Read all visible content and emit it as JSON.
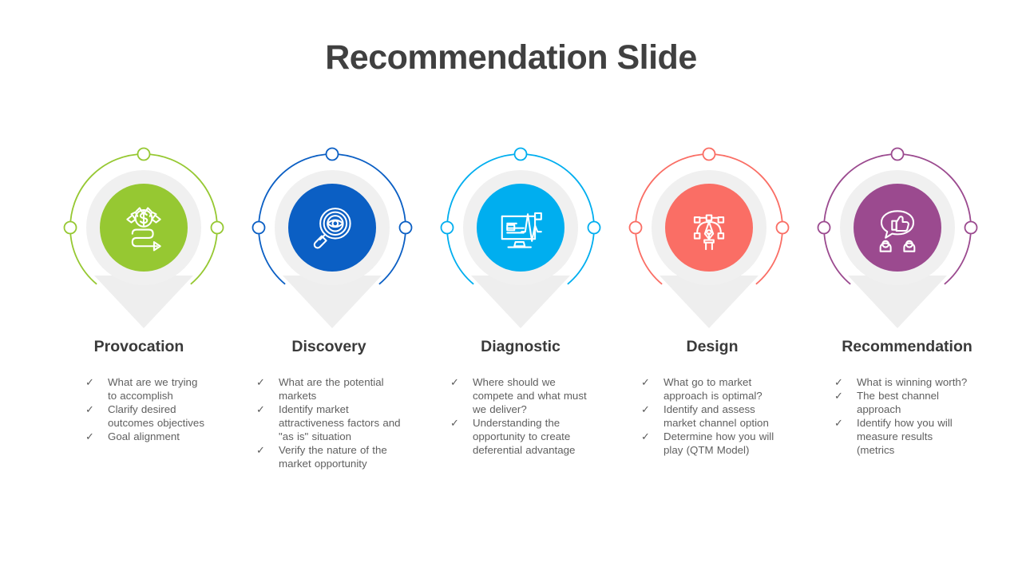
{
  "slide": {
    "title": "Recommendation Slide",
    "background": "#ffffff",
    "title_color": "#404040",
    "arrow_color": "#eeeeee",
    "donut_color": "#f0f0f0",
    "text_color": "#5f5f5f",
    "heading_color": "#3a3a3a",
    "check_glyph": "✓"
  },
  "columns": [
    {
      "id": "provocation",
      "heading": "Provocation",
      "color": "#96C832",
      "icon": "money-growth-icon",
      "bullets": [
        "What are we trying to accomplish",
        "Clarify desired outcomes objectives",
        "Goal alignment"
      ]
    },
    {
      "id": "discovery",
      "heading": "Discovery",
      "color": "#0B5FC4",
      "icon": "magnifier-eye-icon",
      "bullets": [
        "What are the potential markets",
        "Identify market attractiveness factors and \"as is\" situation",
        "Verify the nature of the market opportunity"
      ]
    },
    {
      "id": "diagnostic",
      "heading": "Diagnostic",
      "color": "#00AEEF",
      "icon": "monitor-pulse-icon",
      "bullets": [
        "Where should we compete and what must we deliver?",
        "Understanding  the opportunity to create deferential advantage"
      ]
    },
    {
      "id": "design",
      "heading": "Design",
      "color": "#FA6E65",
      "icon": "pen-tool-icon",
      "bullets": [
        "What go to market approach is optimal?",
        "Identify and assess market channel option",
        "Determine how you will play (QTM Model)"
      ]
    },
    {
      "id": "recommendation",
      "heading": "Recommendation",
      "color": "#9B4A8F",
      "icon": "thumbs-up-speech-people-icon",
      "bullets": [
        "What is winning worth?",
        "The best channel approach",
        "Identify how you will measure results (metrics"
      ]
    }
  ]
}
